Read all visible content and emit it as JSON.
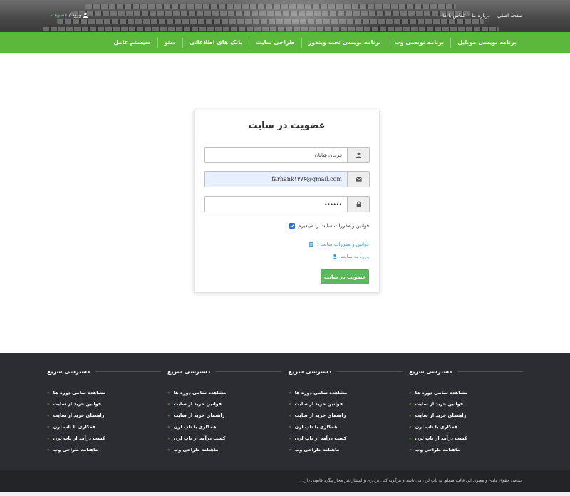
{
  "header": {
    "top_links": [
      "صفحه اصلی",
      "درباره ما",
      "تماس با ما"
    ],
    "login_label": "ورود",
    "separator": "/",
    "signup_label": "عضویت"
  },
  "nav": {
    "items": [
      "برنامه نویسی موبایل",
      "برنامه نویسی وب",
      "برنامه نویسی تحت ویندوز",
      "طراحی سایت",
      "بانک های اطلاعاتی",
      "سئو",
      "سیستم عامل"
    ]
  },
  "form": {
    "title": "عضویت در سایت",
    "name_value": "فرحان شایان",
    "email_value": "farhank۱۳۷۶@gmail.com",
    "password_value": "••••••",
    "terms_label": "قوانین و مقررات سایت را میپذیرم",
    "terms_checked": true,
    "rules_link": "قوانین و مقررات سایت !",
    "login_link": "ورود به سایت",
    "submit_label": "عضویت در سایت"
  },
  "footer": {
    "columns": [
      {
        "title": "دسترسی سریع",
        "items": [
          "مشاهده تمامی دوره ها",
          "قوانین خرید از سایت",
          "راهنمای خرید از سایت",
          "همکاری با تاپ لرن",
          "کسب درآمد از تاپ لرن",
          "ماهنامه طراحی وب"
        ]
      },
      {
        "title": "دسترسی سریع",
        "items": [
          "مشاهده تمامی دوره ها",
          "قوانین خرید از سایت",
          "راهنمای خرید از سایت",
          "همکاری با تاپ لرن",
          "کسب درآمد از تاپ لرن",
          "ماهنامه طراحی وب"
        ]
      },
      {
        "title": "دسترسی سریع",
        "items": [
          "مشاهده تمامی دوره ها",
          "قوانین خرید از سایت",
          "راهنمای خرید از سایت",
          "همکاری با تاپ لرن",
          "کسب درآمد از تاپ لرن",
          "ماهنامه طراحی وب"
        ]
      },
      {
        "title": "دسترسی سریع",
        "items": [
          "مشاهده تمامی دوره ها",
          "قوانین خرید از سایت",
          "راهنمای خرید از سایت",
          "همکاری با تاپ لرن",
          "کسب درآمد از تاپ لرن",
          "ماهنامه طراحی وب"
        ]
      }
    ],
    "bullet": "»",
    "copyright": "تمامی حقوق مادی و معنوی این قالب متعلق به تاپ لرن می باشد و هرگونه کپی برداری و انتشار غیر مجاز پیگرد قانونی دارد ."
  },
  "icons": {
    "user": "user-icon",
    "envelope": "envelope-icon",
    "lock": "lock-icon",
    "checkbox": "check-icon",
    "document": "document-icon"
  },
  "colors": {
    "brand_green": "#5cb83d",
    "button_green": "#5cb85c",
    "link_blue": "#3aa0d8",
    "footer_bg": "#2b2d32",
    "checkbox_blue": "#2a73d6"
  }
}
